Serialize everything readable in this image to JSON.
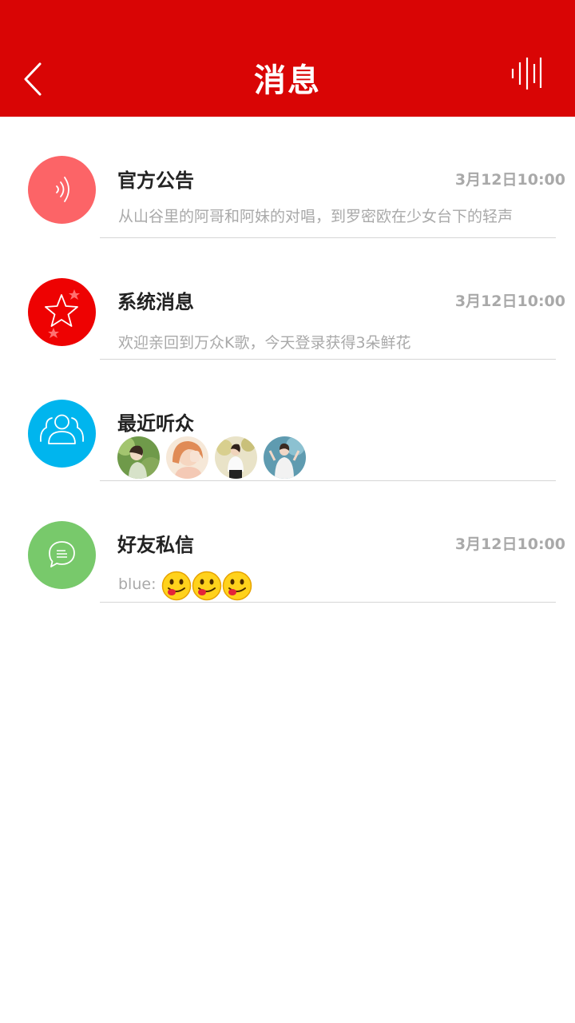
{
  "header": {
    "title": "消息",
    "back_icon": "chevron-left-icon",
    "right_icon": "sound-wave-icon",
    "bg_color": "#d90505"
  },
  "messages": [
    {
      "name": "官方公告",
      "time": "3月12日10:00",
      "preview": "从山谷里的阿哥和阿妹的对唱，到罗密欧在少女台下的轻声",
      "icon": "broadcast-icon",
      "icon_color": "#fc6467"
    },
    {
      "name": "系统消息",
      "time": "3月12日10:00",
      "preview": "欢迎亲回到万众K歌，今天登录获得3朵鲜花",
      "icon": "star-icon",
      "icon_color": "#ee0202"
    },
    {
      "name": "最近听众",
      "icon": "users-icon",
      "icon_color": "#00b5ee",
      "listeners": [
        "listener-avatar-1",
        "listener-avatar-2",
        "listener-avatar-3",
        "listener-avatar-4"
      ]
    },
    {
      "name": "好友私信",
      "time": "3月12日10:00",
      "sender": "blue:",
      "emoji_count": 3,
      "icon": "chat-bubble-icon",
      "icon_color": "#78c96b"
    }
  ]
}
